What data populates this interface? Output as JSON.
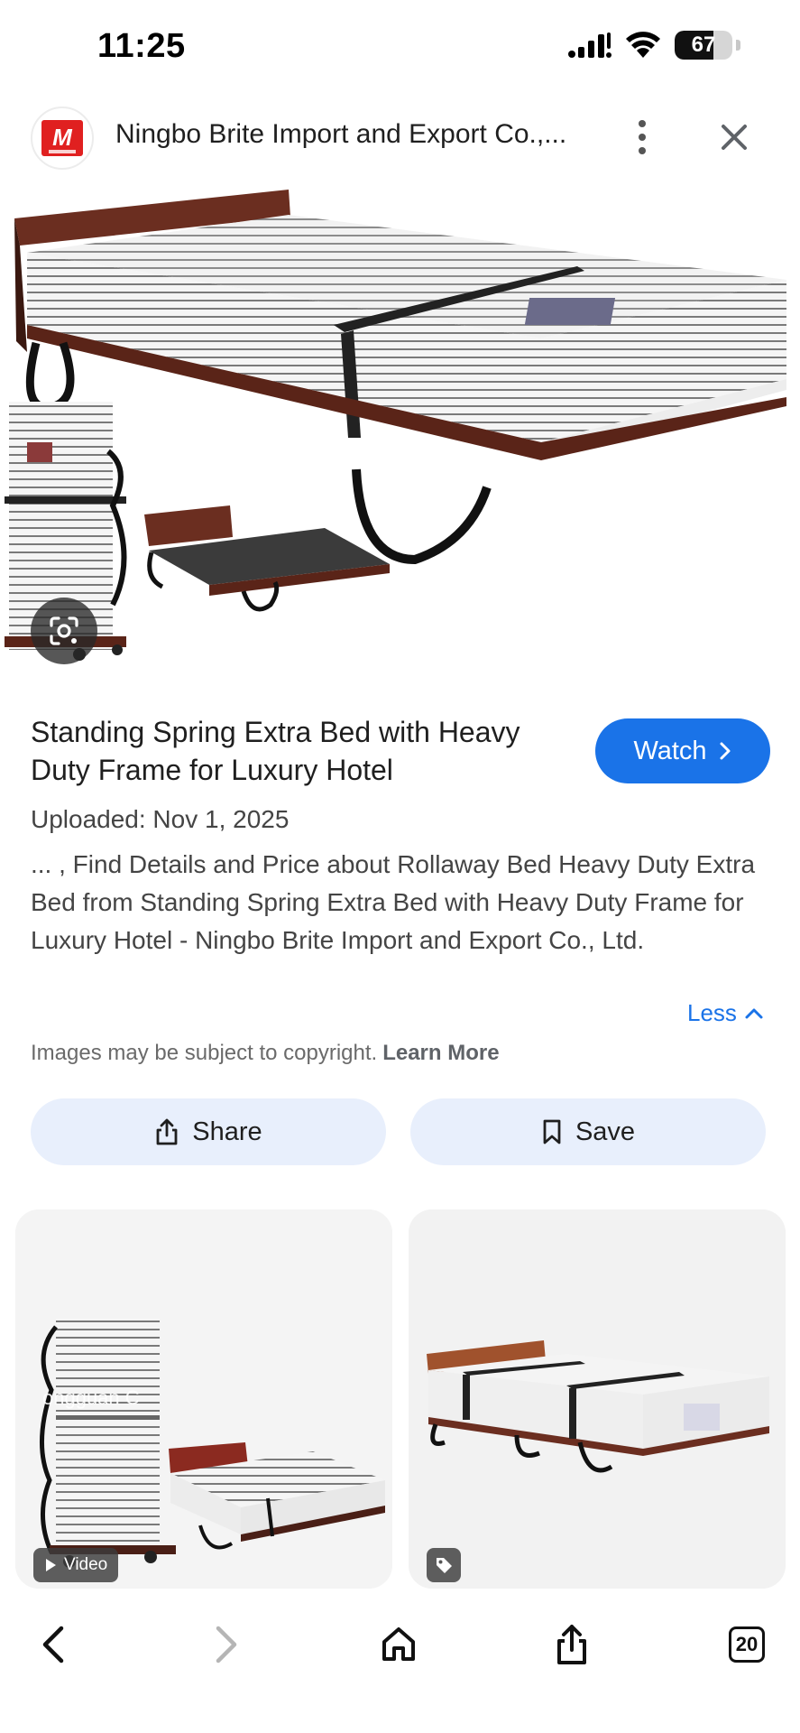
{
  "status_bar": {
    "time": "11:25",
    "battery_level": "67",
    "icons": [
      "cellular-signal-icon",
      "wifi-icon",
      "battery-icon"
    ]
  },
  "header": {
    "site_name": "Ningbo Brite Import and Export Co.,...",
    "logo_icon": "made-in-china-logo-icon",
    "logo_text": "M"
  },
  "main_image": {
    "alt": "Standing Spring Extra Bed with Heavy Duty Frame for Luxury Hotel"
  },
  "info": {
    "title": "Standing Spring Extra Bed with Heavy Duty Frame for Luxury Hotel",
    "watch_label": "Watch",
    "uploaded": "Uploaded: Nov 1, 2025",
    "description": "... , Find Details and Price about Rollaway Bed Heavy Duty Extra Bed from Standing Spring Extra Bed with Heavy Duty Frame for Luxury Hotel - Ningbo Brite Import and Export Co., Ltd.",
    "less_label": "Less",
    "copyright_text": "Images may be subject to copyright.",
    "learn_more_label": "Learn More"
  },
  "actions": {
    "share_label": "Share",
    "save_label": "Save"
  },
  "related": [
    {
      "badge": "Video",
      "watermark": "ongguan C"
    },
    {
      "badge": ""
    }
  ],
  "toolbar": {
    "tabs_count": "20"
  },
  "colors": {
    "accent": "#1a73e8",
    "pill_bg": "#e8effc",
    "text": "#1f1f1f"
  }
}
